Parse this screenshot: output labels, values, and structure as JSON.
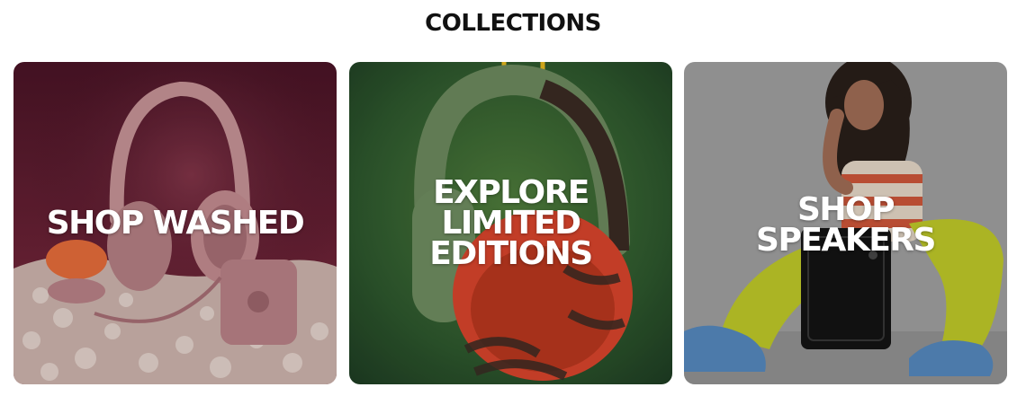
{
  "section": {
    "title": "COLLECTIONS"
  },
  "cards": [
    {
      "label": "SHOP WASHED",
      "image": "pink-headphones-speaker-on-gravel"
    },
    {
      "label": "EXPLORE\nLIMITED\nEDITIONS",
      "image": "green-orange-tiger-stripe-headphones"
    },
    {
      "label": "SHOP\nSPEAKERS",
      "image": "woman-seated-with-speaker"
    }
  ],
  "colors": {
    "heading": "#111111",
    "card_text": "#ffffff",
    "card_a_bg": "#5a1f2e",
    "card_b_bg": "#2f5a2e",
    "card_c_bg": "#a7a7a7"
  }
}
